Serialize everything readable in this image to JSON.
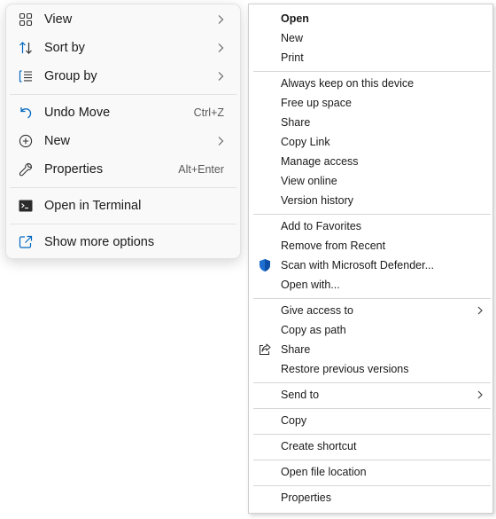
{
  "left_menu": {
    "items": [
      {
        "label": "View",
        "icon": "grid-view-icon"
      },
      {
        "label": "Sort by",
        "icon": "sort-arrows-icon"
      },
      {
        "label": "Group by",
        "icon": "group-list-icon"
      },
      {
        "label": "Undo Move",
        "icon": "undo-icon",
        "shortcut": "Ctrl+Z"
      },
      {
        "label": "New",
        "icon": "plus-circle-icon"
      },
      {
        "label": "Properties",
        "icon": "wrench-icon",
        "shortcut": "Alt+Enter"
      },
      {
        "label": "Open in Terminal",
        "icon": "terminal-icon"
      },
      {
        "label": "Show more options",
        "icon": "expand-icon"
      }
    ]
  },
  "right_menu": {
    "items": [
      {
        "label": "Open"
      },
      {
        "label": "New"
      },
      {
        "label": "Print"
      },
      {
        "label": "Always keep on this device"
      },
      {
        "label": "Free up space"
      },
      {
        "label": "Share"
      },
      {
        "label": "Copy Link"
      },
      {
        "label": "Manage access"
      },
      {
        "label": "View online"
      },
      {
        "label": "Version history"
      },
      {
        "label": "Add to Favorites"
      },
      {
        "label": "Remove from Recent"
      },
      {
        "label": "Scan with Microsoft Defender..."
      },
      {
        "label": "Open with..."
      },
      {
        "label": "Give access to"
      },
      {
        "label": "Copy as path"
      },
      {
        "label": "Share"
      },
      {
        "label": "Restore previous versions"
      },
      {
        "label": "Send to"
      },
      {
        "label": "Copy"
      },
      {
        "label": "Create shortcut"
      },
      {
        "label": "Open file location"
      },
      {
        "label": "Properties"
      }
    ]
  },
  "colors": {
    "accent": "#0067c0",
    "defender_shield": "#1f6fd1",
    "menu_left_bg": "#f9f9f9",
    "menu_right_bg": "#ffffff"
  }
}
